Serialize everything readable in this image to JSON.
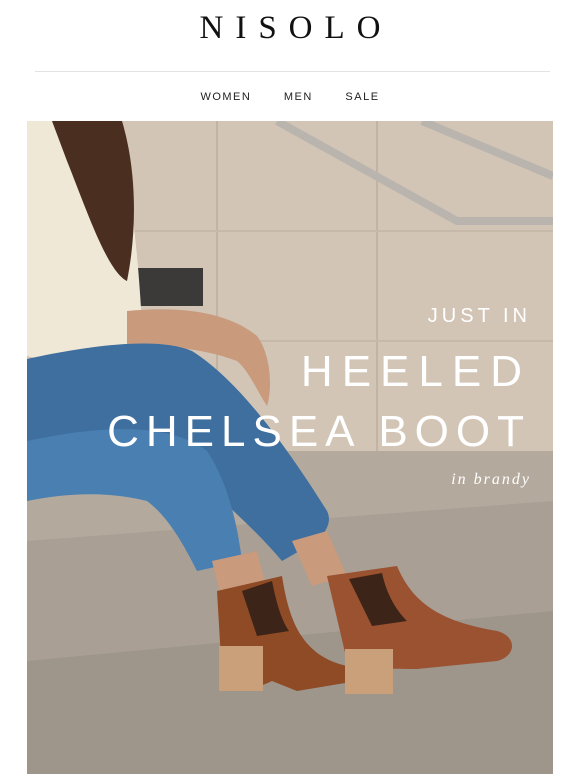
{
  "brand": {
    "logo_text": "NISOLO"
  },
  "nav": {
    "items": [
      "WOMEN",
      "MEN",
      "SALE"
    ]
  },
  "hero": {
    "kicker": "JUST IN",
    "headline_line1": "HEELED",
    "headline_line2": "CHELSEA BOOT",
    "subhead": "in brandy"
  },
  "colors": {
    "boot": "#8f4a26",
    "jeans": "#3e6f9f",
    "stone": "#c9bcac",
    "text_on_hero": "#ffffff"
  }
}
